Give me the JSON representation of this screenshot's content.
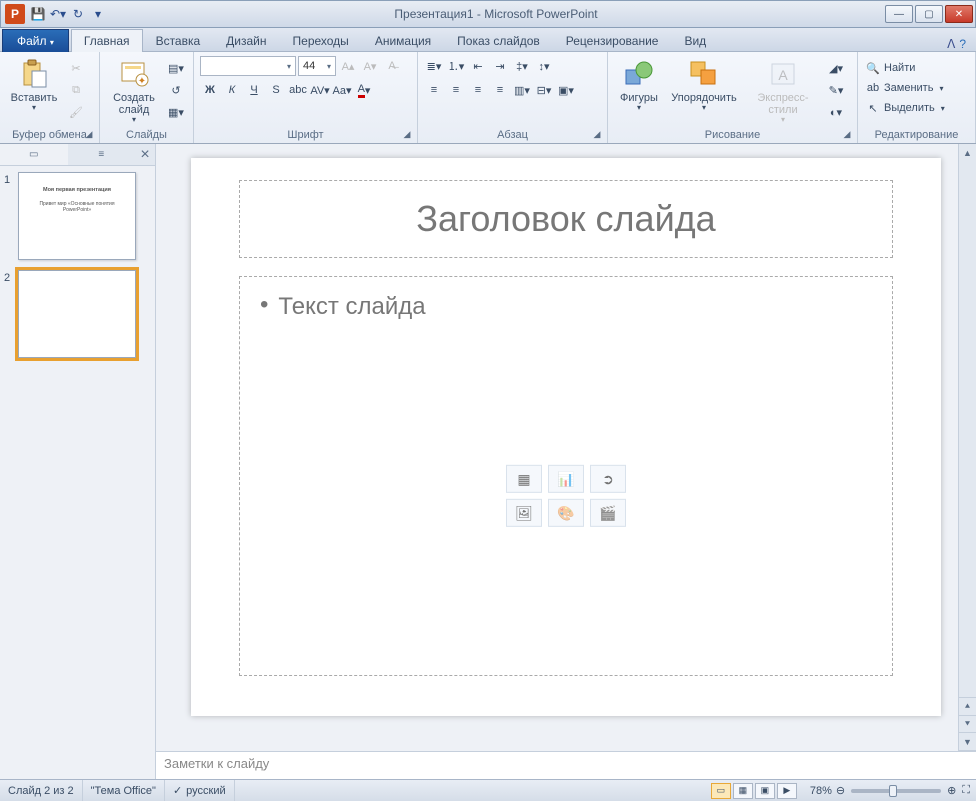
{
  "title": "Презентация1 - Microsoft PowerPoint",
  "tabs": {
    "file": "Файл",
    "items": [
      "Главная",
      "Вставка",
      "Дизайн",
      "Переходы",
      "Анимация",
      "Показ слайдов",
      "Рецензирование",
      "Вид"
    ],
    "active": 0
  },
  "ribbon": {
    "clipboard": {
      "paste": "Вставить",
      "label": "Буфер обмена"
    },
    "slides": {
      "new": "Создать\nслайд",
      "label": "Слайды"
    },
    "font": {
      "name": "",
      "size": "44",
      "label": "Шрифт"
    },
    "para": {
      "label": "Абзац"
    },
    "drawing": {
      "shapes": "Фигуры",
      "arrange": "Упорядочить",
      "styles": "Экспресс-стили",
      "label": "Рисование"
    },
    "editing": {
      "find": "Найти",
      "replace": "Заменить",
      "select": "Выделить",
      "label": "Редактирование"
    }
  },
  "thumbs": {
    "slides": [
      {
        "num": "1",
        "title": "Моя первая презентация",
        "sub": "Привет мир «Основные понятия PowerPoint»"
      },
      {
        "num": "2",
        "title": "",
        "sub": ""
      }
    ],
    "selected": 1
  },
  "slide": {
    "title_placeholder": "Заголовок слайда",
    "body_placeholder": "Текст слайда"
  },
  "notes_placeholder": "Заметки к слайду",
  "status": {
    "slide": "Слайд 2 из 2",
    "theme": "\"Тема Office\"",
    "lang": "русский",
    "zoom": "78%"
  }
}
